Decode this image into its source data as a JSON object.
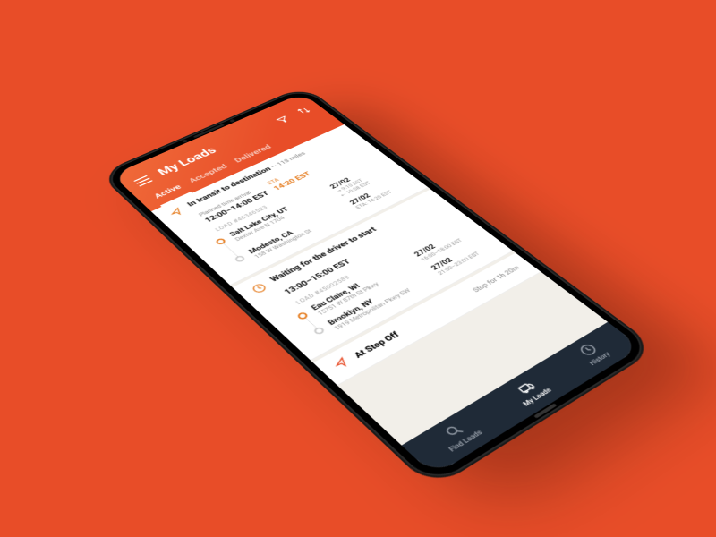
{
  "header": {
    "title": "My Loads",
    "tabs": [
      "Active",
      "Accepted",
      "Delivered"
    ],
    "active_tab_index": 0
  },
  "loads": [
    {
      "status_title": "In transit to destination",
      "status_suffix": "— 118 miles",
      "planned_label": "Planned time arrival",
      "planned_value": "12:00–14:00 EST",
      "eta_label": "ETA",
      "eta_value": "14:20 EST",
      "load_id_label": "LOAD #46346523",
      "stops": [
        {
          "city": "Salt Lake City, UT",
          "addr": "Dexter Ave N 1704",
          "date": "27/02",
          "time_lines": [
            "⇢ 9:10 EST",
            "⇠ 10:58 EST"
          ]
        },
        {
          "city": "Modesto, CA",
          "addr": "158 W Washington St",
          "date": "27/02",
          "time_lines": [
            "ETA: 14:20 EST"
          ]
        }
      ]
    },
    {
      "status_title": "Waiting for the driver to start",
      "planned_value": "13:00–15:00 EST",
      "load_id_label": "LOAD #45002589",
      "stops": [
        {
          "city": "Eau Claire, WI",
          "addr": "15751 W 87th St Pkwy",
          "date": "27/02",
          "time_lines": [
            "16:00–18:00 EST"
          ]
        },
        {
          "city": "Brooklyn, NY",
          "addr": "1919 Metropolitan Pkwy SW",
          "date": "27/02",
          "time_lines": [
            "21:00–23:00 EST"
          ]
        }
      ]
    }
  ],
  "third_strip": {
    "title": "At Stop Off",
    "meta": "Stop for 1h 20m"
  },
  "nav": {
    "items": [
      "Find Loads",
      "My Loads",
      "History"
    ],
    "active_index": 1
  },
  "icons": {
    "send": "send-icon",
    "sort": "sort-icon",
    "clock": "clock-icon",
    "waypoint": "waypoint-icon"
  }
}
